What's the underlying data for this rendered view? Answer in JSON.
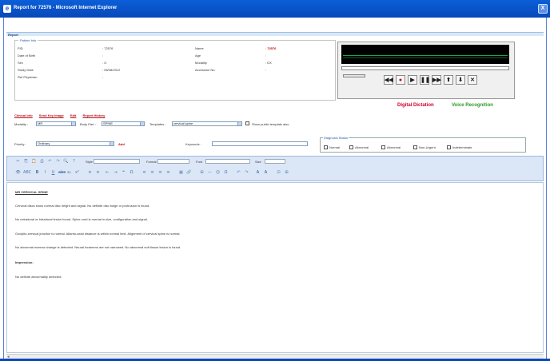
{
  "window": {
    "title": "Report for 72576 - Microsoft Internet Explorer",
    "close_label": "X",
    "ie_glyph": "e"
  },
  "report": {
    "header": "Report"
  },
  "patient_info": {
    "legend": "Patient Info",
    "left": [
      {
        "label": "PID",
        "value": "72576"
      },
      {
        "label": "Date of Birth",
        "value": ""
      },
      {
        "label": "Sex",
        "value": "O"
      },
      {
        "label": "Study Date",
        "value": "06/08/2012"
      },
      {
        "label": "Ref Physician",
        "value": ""
      }
    ],
    "right": [
      {
        "label": "Name",
        "value": "72576"
      },
      {
        "label": "Age",
        "value": ""
      },
      {
        "label": "Modality",
        "value": "DX"
      },
      {
        "label": "Accession No.",
        "value": ""
      }
    ]
  },
  "player": {
    "buttons": [
      {
        "name": "rewind-button",
        "glyph": "◀◀"
      },
      {
        "name": "record-button",
        "glyph": "●"
      },
      {
        "name": "play-button",
        "glyph": "▶"
      },
      {
        "name": "pause-button",
        "glyph": "❚❚"
      },
      {
        "name": "forward-button",
        "glyph": "▶▶"
      },
      {
        "name": "upload-button",
        "glyph": "⬆"
      },
      {
        "name": "download-button",
        "glyph": "⬇"
      },
      {
        "name": "delete-button",
        "glyph": "✕"
      }
    ]
  },
  "dictation": {
    "digital": "Digital Dictation",
    "voice": "Voice Recognition"
  },
  "links": {
    "clinical": "Clinical Info",
    "send_key_image": "Send Key Image",
    "edit": "Edit",
    "report_history": "Report History"
  },
  "filters": {
    "modality_label": "Modality :",
    "modality_value": "MR",
    "body_part_label": "Body Part :",
    "body_part_value": "SPINE",
    "templates_label": "Templates :",
    "templates_value": "cervical spine",
    "show_public": "Show public template also"
  },
  "priority": {
    "label": "Priority :",
    "value": "Ordinary",
    "add": "Add"
  },
  "keywords": {
    "label": "Keywords :",
    "value": ""
  },
  "diagnosis": {
    "legend": "Diagnosis Status",
    "options": [
      "Normal",
      "Abnormal",
      "Abnormal",
      "Non-Urgent",
      "Indeterminate"
    ]
  },
  "toolbar": {
    "style_label": "Style",
    "format_label": "Format",
    "font_label": "Font",
    "size_label": "Size",
    "row1_icons": [
      "✂",
      "⎘",
      "📋",
      "⎙",
      "↶",
      "↷",
      "🔍",
      "?"
    ],
    "row2_icons": [
      "👁",
      "ABC",
      "B",
      "I",
      "U",
      "abc",
      "x₂",
      "x²",
      "≡",
      "≡",
      "⇤",
      "⇥",
      "❝",
      "Ω",
      "≡",
      "≡",
      "≡",
      "≡",
      "▦",
      "🔗",
      "⊞",
      "—",
      "☺",
      "Ω",
      "↶",
      "↷",
      "A",
      "A",
      "⊡",
      "⊞"
    ]
  },
  "content": {
    "heading": "MR CERVICAL SPINE",
    "paragraphs": [
      "Cervical discs show normal disc height and signal. No definite disc bulge or protrusion is found.",
      "No extradural or intradural lesion found. Spine cord is normal in size, configuration and signal.",
      "Occipito-cervical junction is normal. Atlanto-axial distance is within normal limit. Alignment of cervical spine is normal.",
      "No abnormal marrow change is detected. Neural foramens are not narrowed. No abnormal soft tissue lesion is found."
    ],
    "impression_label": "Impression:",
    "impression": "No definite abnormality detected."
  }
}
